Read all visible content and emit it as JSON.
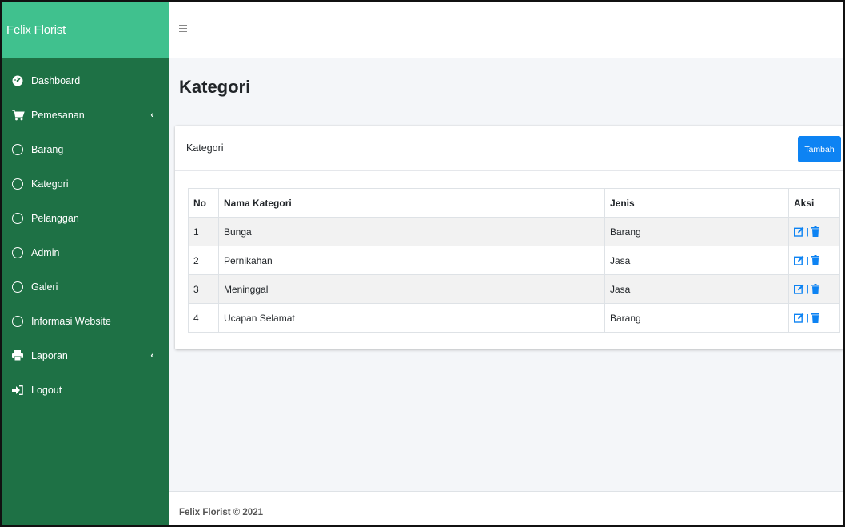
{
  "brand": "Felix Florist",
  "sidebar": {
    "items": [
      {
        "label": "Dashboard",
        "icon": "dashboard-icon"
      },
      {
        "label": "Pemesanan",
        "icon": "shopping-cart-icon",
        "chevron": "‹"
      },
      {
        "label": "Barang",
        "icon": "circle-icon"
      },
      {
        "label": "Kategori",
        "icon": "circle-icon"
      },
      {
        "label": "Pelanggan",
        "icon": "circle-icon"
      },
      {
        "label": "Admin",
        "icon": "circle-icon"
      },
      {
        "label": "Galeri",
        "icon": "circle-icon"
      },
      {
        "label": "Informasi Website",
        "icon": "circle-icon"
      },
      {
        "label": "Laporan",
        "icon": "print-icon",
        "chevron": "‹"
      },
      {
        "label": "Logout",
        "icon": "logout-icon"
      }
    ]
  },
  "page": {
    "title": "Kategori"
  },
  "card": {
    "title": "Kategori",
    "add_label": "Tambah"
  },
  "table": {
    "headers": [
      "No",
      "Nama Kategori",
      "Jenis",
      "Aksi"
    ],
    "rows": [
      {
        "no": "1",
        "nama": "Bunga",
        "jenis": "Barang"
      },
      {
        "no": "2",
        "nama": "Pernikahan",
        "jenis": "Jasa"
      },
      {
        "no": "3",
        "nama": "Meninggal",
        "jenis": "Jasa"
      },
      {
        "no": "4",
        "nama": "Ucapan Selamat",
        "jenis": "Barang"
      }
    ],
    "aksi_separator": "|"
  },
  "footer": {
    "text": "Felix Florist © 2021"
  },
  "colors": {
    "sidebar": "#1e7145",
    "brand_bar": "#40c18e",
    "primary": "#0d83f3"
  }
}
